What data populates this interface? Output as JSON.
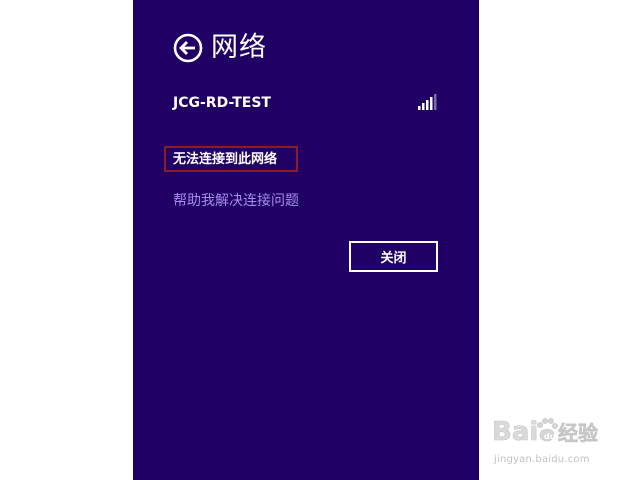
{
  "panel": {
    "title": "网络",
    "back_icon": "back-arrow-circle-icon",
    "network": {
      "name": "JCG-RD-TEST",
      "signal_icon": "wifi-signal-bars-icon"
    },
    "status_text": "无法连接到此网络",
    "help_link": "帮助我解决连接问题",
    "close_label": "关闭"
  },
  "watermark": {
    "logo_text": "Baidu经验",
    "url": "jingyan.baidu.com"
  },
  "colors": {
    "panel_bg": "#200064",
    "link": "#a48cf0",
    "highlight_border": "#8b1a2a"
  }
}
